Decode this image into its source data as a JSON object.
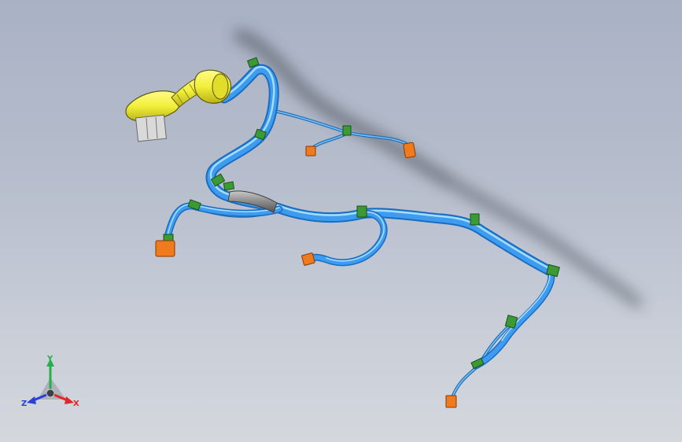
{
  "viewport": {
    "background_top": "#a9b2c5",
    "background_bottom": "#d4d7dd"
  },
  "colors": {
    "harness": "#2e8fe0",
    "harness_highlight": "#8fd0ff",
    "connector_main": "#f2ef3a",
    "terminal_connector": "#f07a1e",
    "clip": "#3c9a35",
    "sleeve": "#8a8a8a",
    "shadow": "#3b3f46"
  },
  "triad": {
    "x_label": "X",
    "y_label": "Y",
    "z_label": "Z",
    "x_color": "#e0262a",
    "y_color": "#22b04a",
    "z_color": "#2a3fd8"
  }
}
